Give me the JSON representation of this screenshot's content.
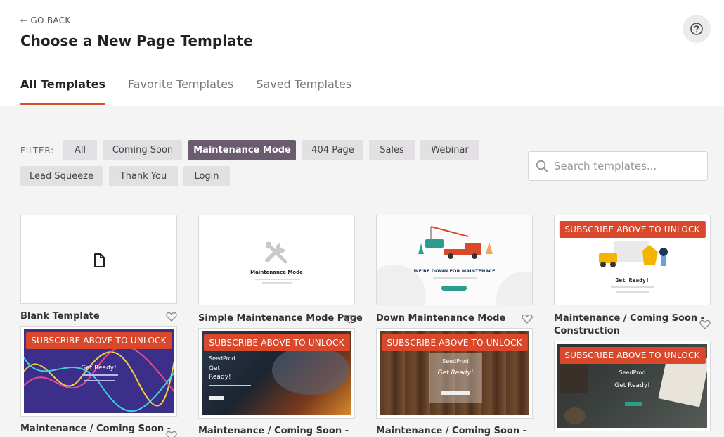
{
  "header": {
    "go_back": "GO BACK",
    "title": "Choose a New Page Template"
  },
  "tabs": [
    {
      "label": "All Templates",
      "active": true
    },
    {
      "label": "Favorite Templates",
      "active": false
    },
    {
      "label": "Saved Templates",
      "active": false
    }
  ],
  "filter": {
    "label": "FILTER:",
    "options": [
      "All",
      "Coming Soon",
      "Maintenance Mode",
      "404 Page",
      "Sales",
      "Webinar",
      "Lead Squeeze",
      "Thank You",
      "Login"
    ],
    "selected": "Maintenance Mode"
  },
  "search": {
    "placeholder": "Search templates..."
  },
  "badge_text": "SUBSCRIBE ABOVE TO UNLOCK",
  "templates": [
    {
      "title": "Blank Template"
    },
    {
      "title": "Simple Maintenance Mode Page",
      "preview_heading": "Maintenance Mode"
    },
    {
      "title": "Down Maintenance Mode",
      "preview_heading": "WE'RE DOWN FOR MAINTENACE"
    },
    {
      "title_line1": "Maintenance / Coming Soon -",
      "title_line2": "Construction",
      "preview_heading": "Get Ready!"
    },
    {
      "title": "Maintenance / Coming Soon -",
      "preview_heading": "Get Ready!"
    },
    {
      "title": "Maintenance / Coming Soon -",
      "preview_heading_1": "Get",
      "preview_heading_2": "Ready!",
      "preview_brand": "SeedProd"
    },
    {
      "title": "Maintenance / Coming Soon -",
      "preview_heading": "Get Ready!",
      "preview_brand": "SeedProd"
    },
    {
      "preview_heading": "Get Ready!",
      "preview_brand": "SeedProd"
    }
  ],
  "colors": {
    "accent": "#dd4d2b",
    "pill_active": "#6b5b6e",
    "badge": "#d9482b"
  }
}
